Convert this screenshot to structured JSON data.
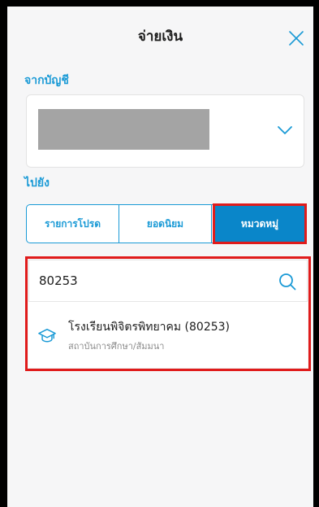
{
  "header": {
    "title": "จ่ายเงิน",
    "close_icon": "close-icon"
  },
  "from_account": {
    "label": "จากบัญชี",
    "chevron_icon": "chevron-down-icon"
  },
  "destination": {
    "label": "ไปยัง",
    "tabs": [
      {
        "label": "รายการโปรด",
        "selected": false
      },
      {
        "label": "ยอดนิยม",
        "selected": false
      },
      {
        "label": "หมวดหมู่",
        "selected": true
      }
    ]
  },
  "search": {
    "value": "80253",
    "icon": "search-icon"
  },
  "results": [
    {
      "name": "โรงเรียนพิจิตรพิทยาคม (80253)",
      "category": "สถาบันการศึกษา/สัมมนา",
      "icon": "graduation-cap-icon"
    }
  ],
  "colors": {
    "accent": "#1a9ad6",
    "active_tab": "#0a86c9",
    "highlight": "#e01b1b",
    "masked_account": "#a4a4a4"
  }
}
